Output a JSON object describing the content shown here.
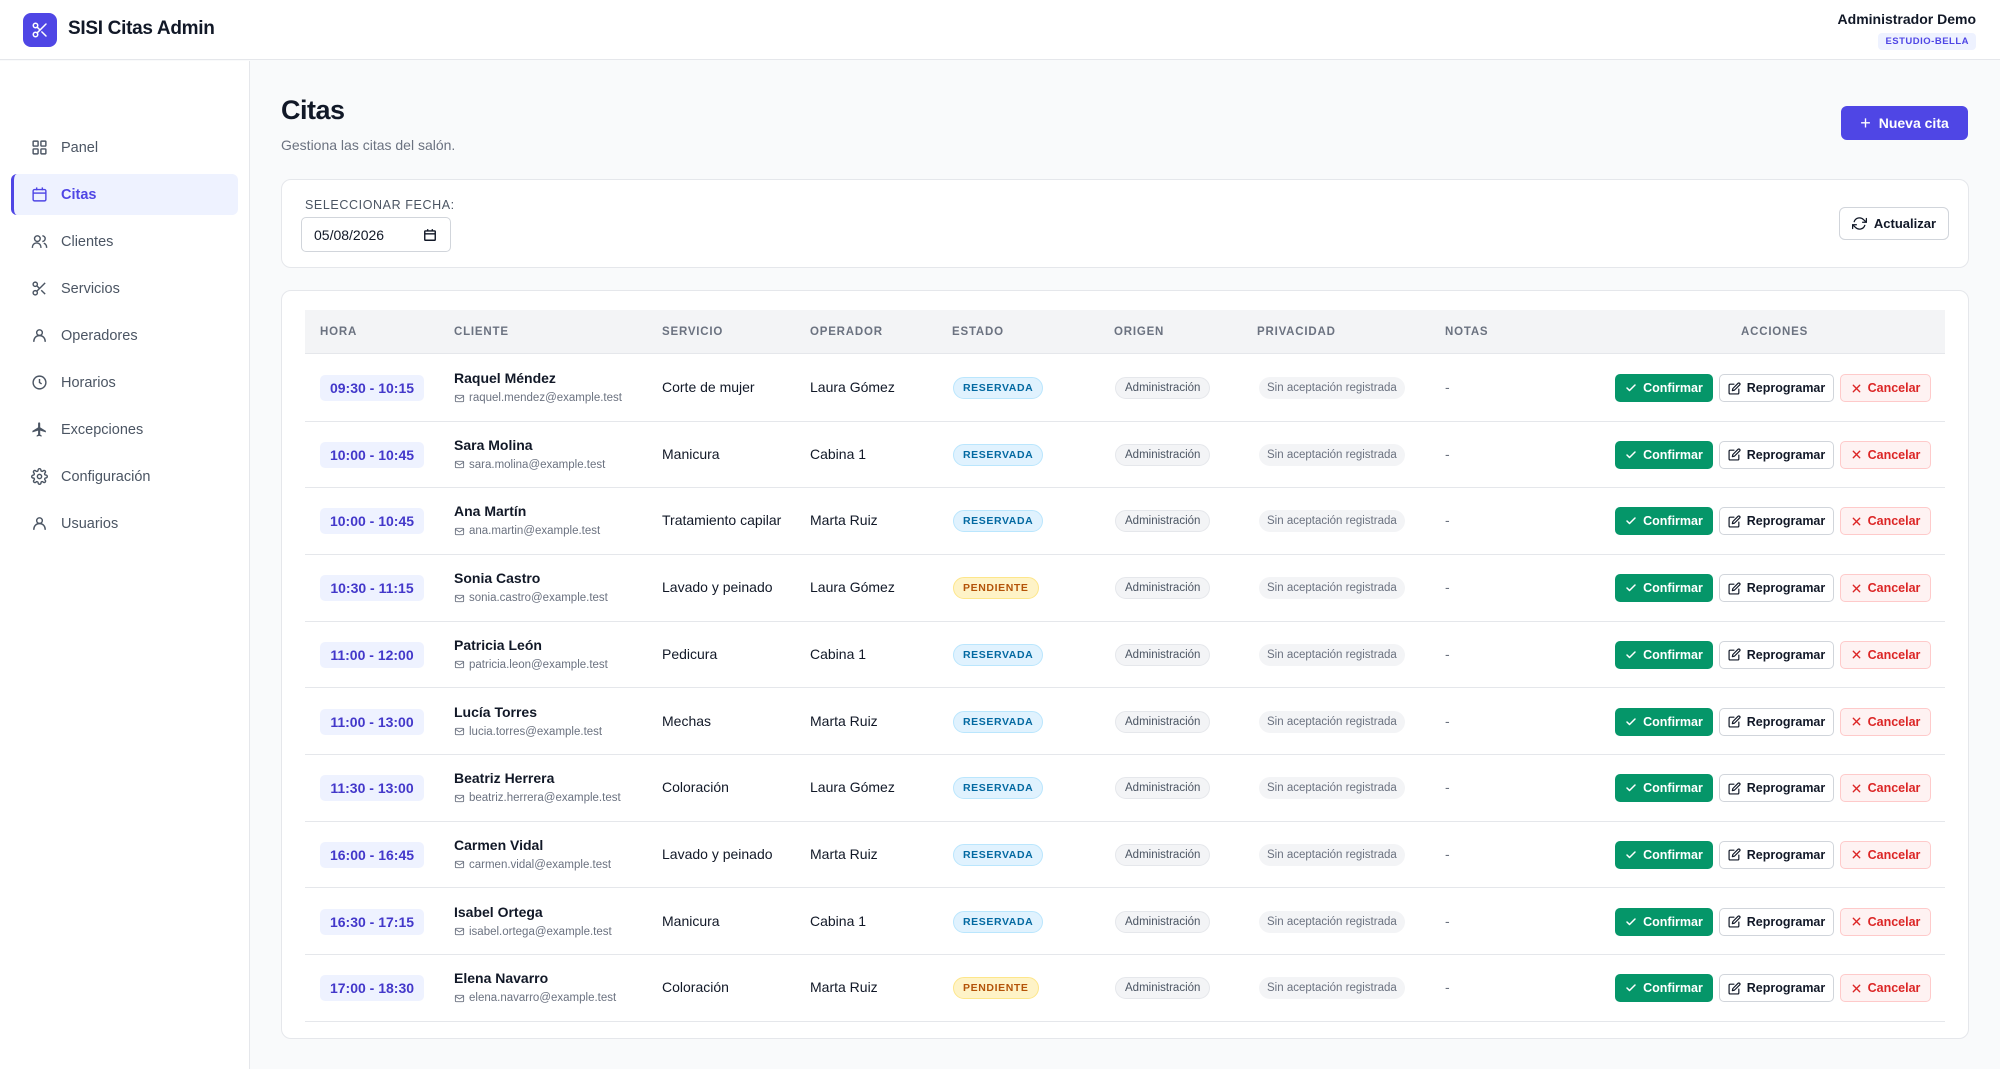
{
  "app": {
    "title": "SISI Citas Admin"
  },
  "user": {
    "name": "Administrador Demo",
    "tenant": "ESTUDIO-BELLA"
  },
  "sidebar": {
    "items": [
      {
        "label": "Panel",
        "icon": "grid-icon",
        "active": false
      },
      {
        "label": "Citas",
        "icon": "calendar-icon",
        "active": true
      },
      {
        "label": "Clientes",
        "icon": "users-icon",
        "active": false
      },
      {
        "label": "Servicios",
        "icon": "scissors-icon",
        "active": false
      },
      {
        "label": "Operadores",
        "icon": "user-icon",
        "active": false
      },
      {
        "label": "Horarios",
        "icon": "clock-icon",
        "active": false
      },
      {
        "label": "Excepciones",
        "icon": "plane-icon",
        "active": false
      },
      {
        "label": "Configuración",
        "icon": "gear-icon",
        "active": false
      },
      {
        "label": "Usuarios",
        "icon": "user-icon",
        "active": false
      }
    ]
  },
  "page": {
    "title": "Citas",
    "subtitle": "Gestiona las citas del salón.",
    "new_button": "Nueva cita"
  },
  "filter": {
    "label": "SELECCIONAR FECHA:",
    "date_value": "05/08/2026",
    "refresh_button": "Actualizar"
  },
  "table": {
    "headers": {
      "hora": "HORA",
      "cliente": "CLIENTE",
      "servicio": "SERVICIO",
      "operador": "OPERADOR",
      "estado": "ESTADO",
      "origen": "ORIGEN",
      "privacidad": "PRIVACIDAD",
      "notas": "NOTAS",
      "acciones": "ACCIONES"
    },
    "actions": {
      "confirm": "Confirmar",
      "reschedule": "Reprogramar",
      "cancel": "Cancelar"
    },
    "rows": [
      {
        "time": "09:30 - 10:15",
        "client": "Raquel Méndez",
        "email": "raquel.mendez@example.test",
        "service": "Corte de mujer",
        "operator": "Laura Gómez",
        "status": "RESERVADA",
        "status_type": "reservada",
        "origin": "Administración",
        "privacy": "Sin aceptación registrada",
        "notes": "-"
      },
      {
        "time": "10:00 - 10:45",
        "client": "Sara Molina",
        "email": "sara.molina@example.test",
        "service": "Manicura",
        "operator": "Cabina 1",
        "status": "RESERVADA",
        "status_type": "reservada",
        "origin": "Administración",
        "privacy": "Sin aceptación registrada",
        "notes": "-"
      },
      {
        "time": "10:00 - 10:45",
        "client": "Ana Martín",
        "email": "ana.martin@example.test",
        "service": "Tratamiento capilar",
        "operator": "Marta Ruiz",
        "status": "RESERVADA",
        "status_type": "reservada",
        "origin": "Administración",
        "privacy": "Sin aceptación registrada",
        "notes": "-"
      },
      {
        "time": "10:30 - 11:15",
        "client": "Sonia Castro",
        "email": "sonia.castro@example.test",
        "service": "Lavado y peinado",
        "operator": "Laura Gómez",
        "status": "PENDIENTE",
        "status_type": "pendiente",
        "origin": "Administración",
        "privacy": "Sin aceptación registrada",
        "notes": "-"
      },
      {
        "time": "11:00 - 12:00",
        "client": "Patricia León",
        "email": "patricia.leon@example.test",
        "service": "Pedicura",
        "operator": "Cabina 1",
        "status": "RESERVADA",
        "status_type": "reservada",
        "origin": "Administración",
        "privacy": "Sin aceptación registrada",
        "notes": "-"
      },
      {
        "time": "11:00 - 13:00",
        "client": "Lucía Torres",
        "email": "lucia.torres@example.test",
        "service": "Mechas",
        "operator": "Marta Ruiz",
        "status": "RESERVADA",
        "status_type": "reservada",
        "origin": "Administración",
        "privacy": "Sin aceptación registrada",
        "notes": "-"
      },
      {
        "time": "11:30 - 13:00",
        "client": "Beatriz Herrera",
        "email": "beatriz.herrera@example.test",
        "service": "Coloración",
        "operator": "Laura Gómez",
        "status": "RESERVADA",
        "status_type": "reservada",
        "origin": "Administración",
        "privacy": "Sin aceptación registrada",
        "notes": "-"
      },
      {
        "time": "16:00 - 16:45",
        "client": "Carmen Vidal",
        "email": "carmen.vidal@example.test",
        "service": "Lavado y peinado",
        "operator": "Marta Ruiz",
        "status": "RESERVADA",
        "status_type": "reservada",
        "origin": "Administración",
        "privacy": "Sin aceptación registrada",
        "notes": "-"
      },
      {
        "time": "16:30 - 17:15",
        "client": "Isabel Ortega",
        "email": "isabel.ortega@example.test",
        "service": "Manicura",
        "operator": "Cabina 1",
        "status": "RESERVADA",
        "status_type": "reservada",
        "origin": "Administración",
        "privacy": "Sin aceptación registrada",
        "notes": "-"
      },
      {
        "time": "17:00 - 18:30",
        "client": "Elena Navarro",
        "email": "elena.navarro@example.test",
        "service": "Coloración",
        "operator": "Marta Ruiz",
        "status": "PENDIENTE",
        "status_type": "pendiente",
        "origin": "Administración",
        "privacy": "Sin aceptación registrada",
        "notes": "-"
      }
    ]
  },
  "colors": {
    "accent": "#4f46e5",
    "confirm": "#059669",
    "cancel": "#dc2626"
  }
}
